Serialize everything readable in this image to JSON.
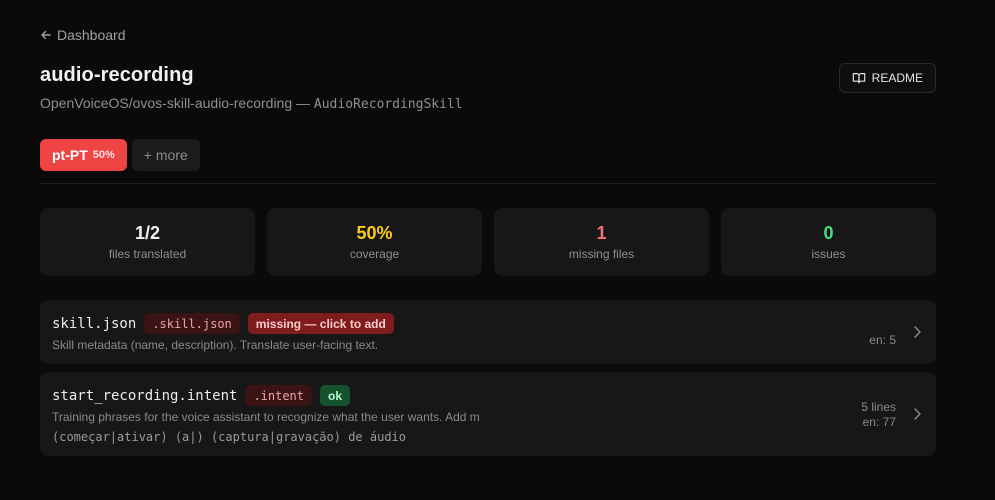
{
  "nav": {
    "back_label": "Dashboard"
  },
  "header": {
    "title": "audio-recording",
    "repo": "OpenVoiceOS/ovos-skill-audio-recording",
    "separator": " — ",
    "class_name": "AudioRecordingSkill",
    "readme_label": "README"
  },
  "languages": {
    "active": {
      "code": "pt-PT",
      "percent": "50%"
    },
    "more_label": "+ more"
  },
  "stats": [
    {
      "value": "1/2",
      "label": "files translated",
      "color": "#f2f2f2"
    },
    {
      "value": "50%",
      "label": "coverage",
      "color": "#facc15"
    },
    {
      "value": "1",
      "label": "missing files",
      "color": "#f87171"
    },
    {
      "value": "0",
      "label": "issues",
      "color": "#4ade80"
    }
  ],
  "files": [
    {
      "name": "skill.json",
      "ext": ".skill.json",
      "status": "missing — click to add",
      "description": "Skill metadata (name, description). Translate user-facing text.",
      "meta_en": "en: 5"
    },
    {
      "name": "start_recording.intent",
      "ext": ".intent",
      "status": "ok",
      "description": "Training phrases for the voice assistant to recognize what the user wants. Add m",
      "sample": "(começar|ativar) (a|) (captura|gravação) de áudio",
      "meta_lines": "5 lines",
      "meta_en": "en: 77"
    }
  ],
  "icons": {
    "back": "arrow-left-icon",
    "readme": "book-open-icon",
    "row": "chevron-right-icon"
  }
}
